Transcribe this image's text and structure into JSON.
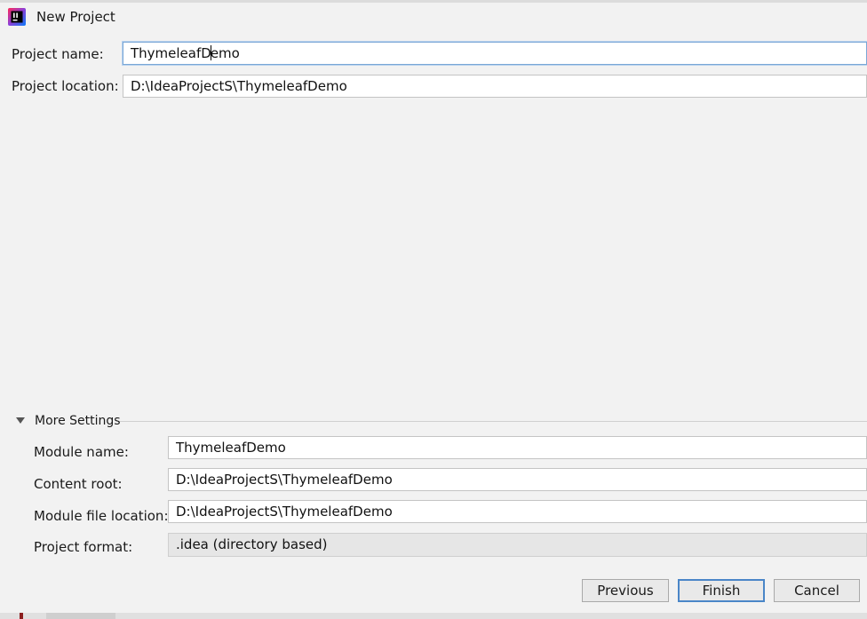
{
  "window": {
    "title": "New Project"
  },
  "project": {
    "name_label": "Project name:",
    "name_value": "ThymeleafDemo",
    "location_label": "Project location:",
    "location_value": "D:\\IdeaProjectS\\ThymeleafDemo"
  },
  "more_settings": {
    "header": "More Settings",
    "module_name_label": "Module name:",
    "module_name_value": "ThymeleafDemo",
    "content_root_label": "Content root:",
    "content_root_value": "D:\\IdeaProjectS\\ThymeleafDemo",
    "module_file_location_label": "Module file location:",
    "module_file_location_value": "D:\\IdeaProjectS\\ThymeleafDemo",
    "project_format_label": "Project format:",
    "project_format_value": ".idea (directory based)"
  },
  "buttons": {
    "previous": "Previous",
    "finish": "Finish",
    "cancel": "Cancel"
  },
  "icons": {
    "app": "intellij-idea-icon",
    "collapse": "triangle-down-icon"
  },
  "colors": {
    "background": "#f2f2f2",
    "focus_border": "#7aa7d6",
    "default_button_border": "#4a86c8",
    "readonly_field": "#e6e6e6"
  }
}
